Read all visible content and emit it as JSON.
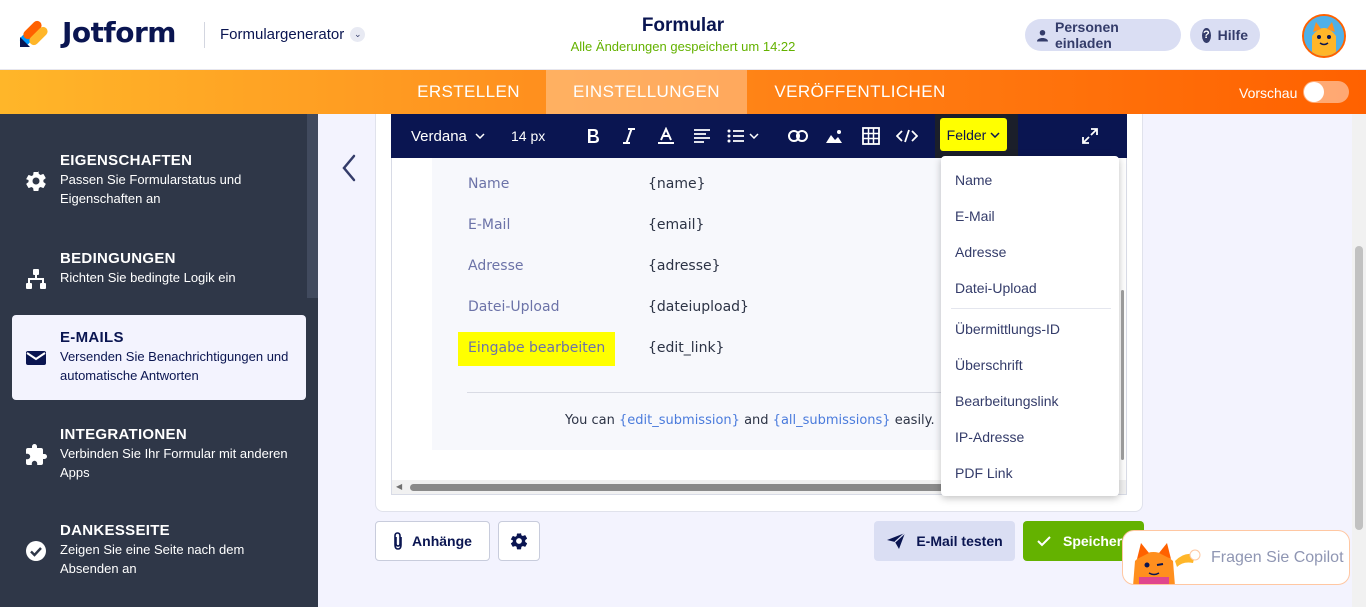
{
  "header": {
    "logo_text": "Jotform",
    "builder_label": "Formulargenerator",
    "form_title": "Formular",
    "saved_status": "Alle Änderungen gespeichert um 14:22",
    "invite_label": "Personen einladen",
    "help_label": "Hilfe"
  },
  "nav": {
    "tabs": [
      {
        "label": "ERSTELLEN"
      },
      {
        "label": "EINSTELLUNGEN"
      },
      {
        "label": "VERÖFFENTLICHEN"
      }
    ],
    "active_tab": "EINSTELLUNGEN",
    "preview_label": "Vorschau",
    "preview_on": false
  },
  "sidebar": {
    "items": [
      {
        "title": "EIGENSCHAFTEN",
        "desc": "Passen Sie Formularstatus und Eigenschaften an",
        "icon": "gear-icon"
      },
      {
        "title": "BEDINGUNGEN",
        "desc": "Richten Sie bedingte Logik ein",
        "icon": "hierarchy-icon"
      },
      {
        "title": "E-MAILS",
        "desc": "Versenden Sie Benachrichtigungen und automatische Antworten",
        "icon": "envelope-icon",
        "active": true
      },
      {
        "title": "INTEGRATIONEN",
        "desc": "Verbinden Sie Ihr Formular mit anderen Apps",
        "icon": "puzzle-icon"
      },
      {
        "title": "DANKESSEITE",
        "desc": "Zeigen Sie eine Seite nach dem Absenden an",
        "icon": "check-circle-icon"
      }
    ]
  },
  "toolbar": {
    "font_family": "Verdana",
    "font_size": "14 px",
    "fields_button": "Felder"
  },
  "email_body": {
    "rows": [
      {
        "label": "Name",
        "value": "{name}"
      },
      {
        "label": "E-Mail",
        "value": "{email}"
      },
      {
        "label": "Adresse",
        "value": "{adresse}"
      },
      {
        "label": "Datei-Upload",
        "value": "{dateiupload}"
      },
      {
        "label": "Eingabe bearbeiten",
        "value": "{edit_link}"
      }
    ],
    "footer_prefix": "You can ",
    "footer_var1": "{edit_submission}",
    "footer_mid": " and ",
    "footer_var2": "{all_submissions}",
    "footer_suffix": " easily."
  },
  "fields_dropdown": {
    "items": [
      "Name",
      "E-Mail",
      "Adresse",
      "Datei-Upload",
      "Übermittlungs-ID",
      "Überschrift",
      "Bearbeitungslink",
      "IP-Adresse",
      "PDF Link"
    ]
  },
  "buttons": {
    "attachments": "Anhänge",
    "test_email": "E-Mail testen",
    "save": "Speichern"
  },
  "copilot": {
    "placeholder": "Fragen Sie Copilot"
  },
  "colors": {
    "brand_navy": "#0a1551",
    "orange": "#ff6100",
    "green": "#64b200",
    "highlight": "#ffff00",
    "sidebar_bg": "#2f3748"
  }
}
